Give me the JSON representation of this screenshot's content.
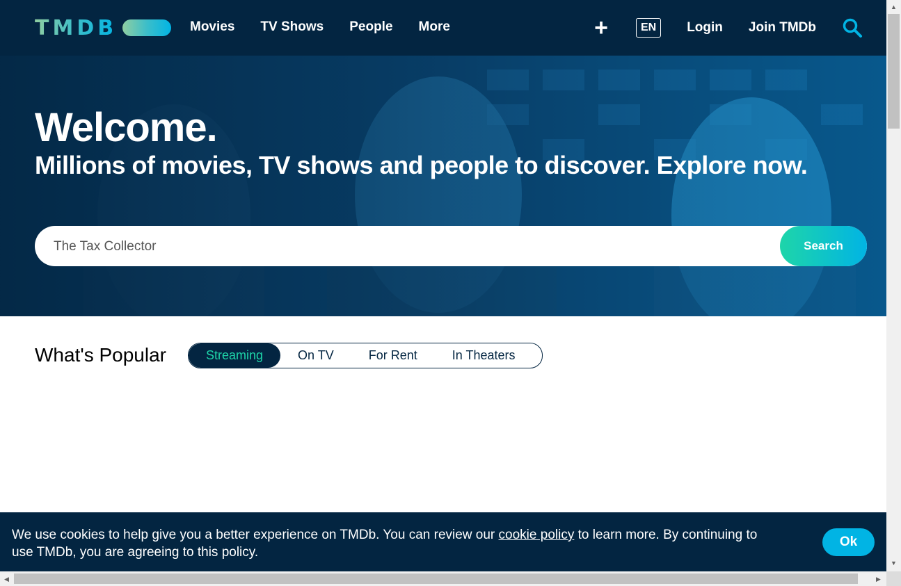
{
  "brand": {
    "logo_text": "TMDB"
  },
  "nav": {
    "left": [
      "Movies",
      "TV Shows",
      "People",
      "More"
    ],
    "add_icon": "plus-icon",
    "language": "EN",
    "login": "Login",
    "join": "Join TMDb",
    "search_icon": "search-icon"
  },
  "hero": {
    "title": "Welcome.",
    "subtitle": "Millions of movies, TV shows and people to discover. Explore now.",
    "search_value": "The Tax Collector",
    "search_button": "Search"
  },
  "popular": {
    "title": "What's Popular",
    "tabs": [
      "Streaming",
      "On TV",
      "For Rent",
      "In Theaters"
    ],
    "active_tab": "Streaming"
  },
  "cookie": {
    "text_before": "We use cookies to help give you a better experience on TMDb. You can review our ",
    "link": "cookie policy",
    "text_after": " to learn more. By continuing to use TMDb, you are agreeing to this policy.",
    "ok": "Ok"
  },
  "colors": {
    "primary_dark": "#032541",
    "accent_teal": "#1ed5a9",
    "accent_blue": "#01b4e4",
    "logo_green": "#90cea1"
  }
}
